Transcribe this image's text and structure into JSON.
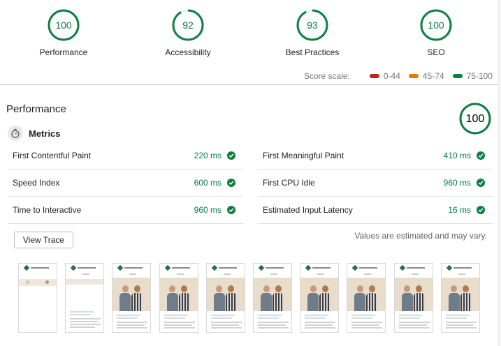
{
  "categories": [
    {
      "label": "Performance",
      "score": "100",
      "value": 100,
      "color": "#0b8043"
    },
    {
      "label": "Accessibility",
      "score": "92",
      "value": 92,
      "color": "#0b8043"
    },
    {
      "label": "Best Practices",
      "score": "93",
      "value": 93,
      "color": "#0b8043"
    },
    {
      "label": "SEO",
      "score": "100",
      "value": 100,
      "color": "#0b8043"
    }
  ],
  "scale": {
    "label": "Score scale:",
    "ranges": [
      {
        "text": "0-44",
        "color": "#c5221f"
      },
      {
        "text": "45-74",
        "color": "#e67700"
      },
      {
        "text": "75-100",
        "color": "#0b8043"
      }
    ]
  },
  "performance": {
    "title": "Performance",
    "score": "100",
    "value": 100,
    "metrics_title": "Metrics",
    "metrics": [
      {
        "name": "First Contentful Paint",
        "value": "220 ms"
      },
      {
        "name": "First Meaningful Paint",
        "value": "410 ms"
      },
      {
        "name": "Speed Index",
        "value": "600 ms"
      },
      {
        "name": "First CPU Idle",
        "value": "960 ms"
      },
      {
        "name": "Time to Interactive",
        "value": "960 ms"
      },
      {
        "name": "Estimated Input Latency",
        "value": "16 ms"
      }
    ],
    "view_trace": "View Trace",
    "note": "Values are estimated and may vary."
  },
  "filmstrip": [
    {
      "state": "blank"
    },
    {
      "state": "partial"
    },
    {
      "state": "full"
    },
    {
      "state": "full"
    },
    {
      "state": "full"
    },
    {
      "state": "full"
    },
    {
      "state": "full"
    },
    {
      "state": "full"
    },
    {
      "state": "full"
    },
    {
      "state": "full"
    }
  ]
}
